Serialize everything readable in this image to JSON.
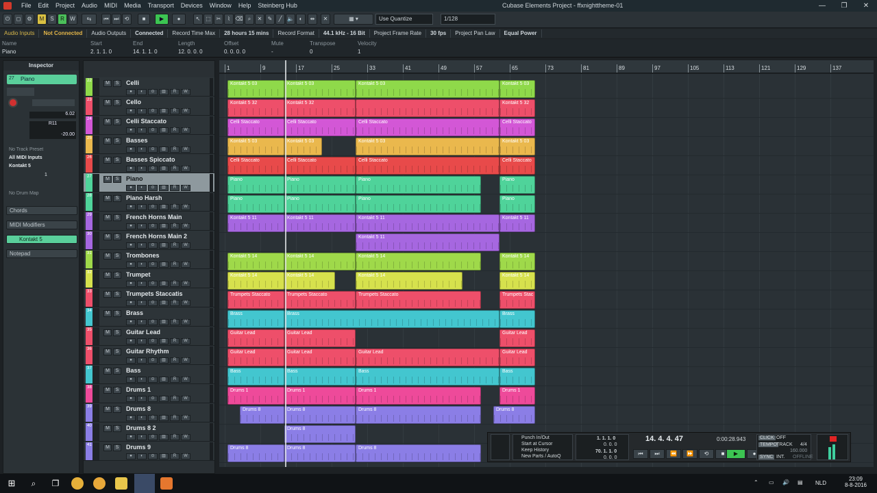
{
  "window": {
    "title": "Cubase Elements Project - ffxnighttheme-01",
    "controls": [
      "—",
      "❐",
      "✕"
    ]
  },
  "menu": [
    "File",
    "Edit",
    "Project",
    "Audio",
    "MIDI",
    "Media",
    "Transport",
    "Devices",
    "Window",
    "Help",
    "Steinberg Hub"
  ],
  "toolbar": {
    "mode_buttons": [
      "M",
      "S",
      "R",
      "W"
    ],
    "quantize_label": "Use Quantize",
    "quantize_value": "1/128"
  },
  "status": [
    "Audio Inputs",
    "Not Connected",
    "Audio Outputs",
    "Connected",
    "Record Time Max",
    "28 hours 15 mins",
    "Record Format",
    "44.1 kHz - 16 Bit",
    "Project Frame Rate",
    "30 fps",
    "Project Pan Law",
    "Equal Power"
  ],
  "info": {
    "name_label": "Name",
    "name_value": "Piano",
    "cols": [
      {
        "label": "Start",
        "value": "2. 1. 1.   0"
      },
      {
        "label": "End",
        "value": "14. 1. 1.   0"
      },
      {
        "label": "Length",
        "value": "12. 0. 0.   0"
      },
      {
        "label": "Offset",
        "value": "0. 0. 0.   0"
      },
      {
        "label": "Mute",
        "value": "-"
      },
      {
        "label": "Transpose",
        "value": "0"
      },
      {
        "label": "Velocity",
        "value": "1"
      }
    ]
  },
  "inspector": {
    "title": "Inspector",
    "track_number": "27",
    "track_name": "Piano",
    "volume": "6.02",
    "pan": "R11",
    "send": "-20.00",
    "preset": "No Track Preset",
    "input": "All MIDI Inputs",
    "output": "Kontakt 5",
    "channel": "1",
    "drum_map": "No Drum Map",
    "sections": [
      "Chords",
      "MIDI Modifiers",
      "Kontakt 5",
      "Notepad"
    ]
  },
  "tracks": [
    {
      "name": "Celli",
      "num": "22",
      "color": "#8fd94a"
    },
    {
      "name": "Cello",
      "num": "23",
      "color": "#ee4f6a"
    },
    {
      "name": "Celli Staccato",
      "num": "24",
      "color": "#d357d6"
    },
    {
      "name": "Basses",
      "num": "25",
      "color": "#eab84d"
    },
    {
      "name": "Basses Spiccato",
      "num": "26",
      "color": "#e84a4a"
    },
    {
      "name": "Piano",
      "num": "27",
      "color": "#4fd39a"
    },
    {
      "name": "Piano Harsh",
      "num": "28",
      "color": "#4fd39a"
    },
    {
      "name": "French Horns Main",
      "num": "29",
      "color": "#a667e0"
    },
    {
      "name": "French Horns Main 2",
      "num": "30",
      "color": "#a667e0"
    },
    {
      "name": "Trombones",
      "num": "31",
      "color": "#9fd94a"
    },
    {
      "name": "Trumpet",
      "num": "32",
      "color": "#d6e14d"
    },
    {
      "name": "Trumpets Staccatis",
      "num": "33",
      "color": "#ee4f6a"
    },
    {
      "name": "Brass",
      "num": "34",
      "color": "#43c6cf"
    },
    {
      "name": "Guitar Lead",
      "num": "35",
      "color": "#ee4f6a"
    },
    {
      "name": "Guitar Rhythm",
      "num": "36",
      "color": "#ee4f6a"
    },
    {
      "name": "Bass",
      "num": "37",
      "color": "#43c6cf"
    },
    {
      "name": "Drums 1",
      "num": "38",
      "color": "#ee4a9a"
    },
    {
      "name": "Drums 8",
      "num": "39",
      "color": "#8b7ee6"
    },
    {
      "name": "Drums 8 2",
      "num": "40",
      "color": "#8b7ee6"
    },
    {
      "name": "Drums 9",
      "num": "41",
      "color": "#8b7ee6"
    }
  ],
  "ruler": [
    "1",
    "9",
    "17",
    "25",
    "33",
    "41",
    "49",
    "57",
    "65",
    "73",
    "81",
    "89",
    "97",
    "105",
    "113",
    "121",
    "129",
    "137"
  ],
  "lanes": [
    [
      [
        "Kontakt 5 03",
        0,
        83
      ],
      [
        "Kontakt 5 03",
        83,
        104
      ],
      [
        "Kontakt 5 03",
        187,
        210
      ],
      [
        "Kontakt 5 03",
        397,
        52
      ]
    ],
    [
      [
        "Kontakt 5 32",
        0,
        83
      ],
      [
        "Kontakt 5 32",
        83,
        104
      ],
      [
        "",
        187,
        210
      ],
      [
        "Kontakt 5 32",
        397,
        52
      ]
    ],
    [
      [
        "Celli Staccato",
        0,
        83
      ],
      [
        "Celli Staccato",
        83,
        104
      ],
      [
        "Celli Staccato",
        187,
        210
      ],
      [
        "Celli Staccato",
        397,
        52
      ]
    ],
    [
      [
        "Kontakt 5 03",
        0,
        83
      ],
      [
        "Kontakt 5 03",
        83,
        55
      ],
      [
        "Kontakt 5 03",
        187,
        210
      ],
      [
        "Kontakt 5 03",
        397,
        52
      ]
    ],
    [
      [
        "Celli Staccato",
        0,
        83
      ],
      [
        "Celli Staccato",
        83,
        104
      ],
      [
        "Celli Staccato",
        187,
        210
      ],
      [
        "Celli Staccato",
        397,
        52
      ]
    ],
    [
      [
        "Piano",
        0,
        83
      ],
      [
        "Piano",
        83,
        104
      ],
      [
        "Piano",
        187,
        183
      ],
      [
        "Piano",
        397,
        52
      ]
    ],
    [
      [
        "Piano",
        0,
        83
      ],
      [
        "Piano",
        83,
        104
      ],
      [
        "Piano",
        187,
        183
      ],
      [
        "Piano",
        397,
        52
      ]
    ],
    [
      [
        "Kontakt 5 11",
        0,
        83
      ],
      [
        "Kontakt 5 11",
        83,
        104
      ],
      [
        "Kontakt 5 11",
        187,
        210
      ],
      [
        "Kontakt 5 11",
        397,
        52
      ]
    ],
    [
      [
        "Kontakt 5 11",
        187,
        210
      ]
    ],
    [
      [
        "Kontakt 5 14",
        0,
        83
      ],
      [
        "Kontakt 5 14",
        83,
        104
      ],
      [
        "Kontakt 5 14",
        187,
        183
      ],
      [
        "Kontakt 5 14",
        397,
        52
      ]
    ],
    [
      [
        "Kontakt 5 14",
        0,
        83
      ],
      [
        "Kontakt 5 14",
        83,
        74
      ],
      [
        "Kontakt 5 14",
        187,
        156
      ],
      [
        "Kontakt 5 14",
        397,
        52
      ]
    ],
    [
      [
        "Trumpets Staccato",
        0,
        83
      ],
      [
        "Trumpets Staccato",
        83,
        104
      ],
      [
        "Trumpets Staccato",
        187,
        183
      ],
      [
        "Trumpets Stac",
        397,
        52
      ]
    ],
    [
      [
        "Brass",
        0,
        83
      ],
      [
        "Brass",
        83,
        314
      ],
      [
        "Brass",
        397,
        52
      ]
    ],
    [
      [
        "Guitar Lead",
        0,
        83
      ],
      [
        "Guitar Lead",
        83,
        104
      ],
      [
        "Guitar Lead",
        397,
        52
      ]
    ],
    [
      [
        "Guitar Lead",
        0,
        83
      ],
      [
        "Guitar Lead",
        83,
        104
      ],
      [
        "Guitar Lead",
        187,
        210
      ],
      [
        "Guitar Lead",
        397,
        52
      ]
    ],
    [
      [
        "Bass",
        0,
        83
      ],
      [
        "Bass",
        83,
        104
      ],
      [
        "Bass",
        187,
        210
      ],
      [
        "Bass",
        397,
        52
      ]
    ],
    [
      [
        "Drums 1",
        0,
        83
      ],
      [
        "Drums 1",
        83,
        104
      ],
      [
        "Drums 1",
        187,
        183
      ],
      [
        "Drums 1",
        397,
        52
      ]
    ],
    [
      [
        "Drums 8",
        18,
        65
      ],
      [
        "Drums 8",
        83,
        104
      ],
      [
        "Drums 8",
        187,
        183
      ],
      [
        "Drums 8",
        388,
        61
      ]
    ],
    [
      [
        "Drums 8",
        83,
        104
      ]
    ],
    [
      [
        "Drums 8",
        0,
        83
      ],
      [
        "Drums 8",
        83,
        104
      ],
      [
        "Drums 8",
        187,
        183
      ]
    ]
  ],
  "transport": {
    "punch": [
      "Punch In/Out",
      "Start at Cursor",
      "Keep History",
      "New Parts / AutoQ"
    ],
    "left_locator": "1. 1. 1.   0",
    "left_sub": "0.   0. 0",
    "right_locator": "70. 1. 1.   0",
    "right_sub": "0.   0. 0",
    "position": "14. 4. 4. 47",
    "time": "0:00:28.943",
    "click": "CLICK",
    "click_state": "OFF",
    "tempo": "TEMPO",
    "tempo_mode": "TRACK",
    "signature": "4/4",
    "bpm": "160.000",
    "sync": "SYNC",
    "sync_mode": "INT.",
    "offline": "OFFLINE"
  },
  "taskbar": {
    "lang": "NLD",
    "time": "23:09",
    "date": "8-8-2016"
  }
}
